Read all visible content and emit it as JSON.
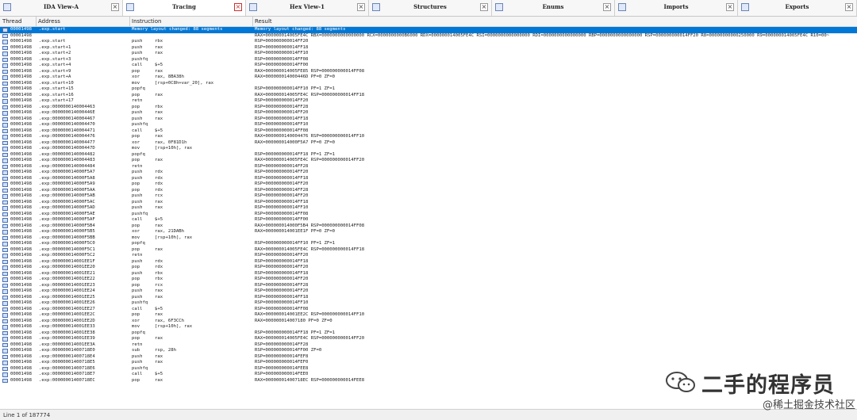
{
  "tabs": [
    {
      "label": "IDA View-A",
      "active": false
    },
    {
      "label": "Tracing",
      "active": true
    },
    {
      "label": "Hex View-1",
      "active": false
    },
    {
      "label": "Structures",
      "active": false
    },
    {
      "label": "Enums",
      "active": false
    },
    {
      "label": "Imports",
      "active": false
    },
    {
      "label": "Exports",
      "active": false
    }
  ],
  "columns": {
    "thread": "Thread",
    "address": "Address",
    "instruction": "Instruction",
    "result": "Result"
  },
  "rows": [
    {
      "t": "00001498",
      "a": ".exp.start",
      "m": "Memory layout changed: 88 segments",
      "o": "",
      "r": "Memory layout changed: 88 segments",
      "sel": true
    },
    {
      "t": "00001498",
      "a": "",
      "m": "",
      "o": "",
      "r": "RAX=000000014005FE4C RBX=0000000000000000 RCX=0000000000B6000 RDX=000000014005FE4C RSI=0000000000000000 RDI=0000000000000000 RBP=0000000000000000 RSP=000000000014FF20 R8=00000000000250000 R9=000000014005FE4C R10=00~"
    },
    {
      "t": "00001498",
      "a": ".exp.start",
      "m": "push",
      "o": "rbx",
      "r": "RSP=000000000014FF20"
    },
    {
      "t": "00001498",
      "a": ".exp.start+1",
      "m": "push",
      "o": "rax",
      "r": "RSP=000000000014FF18"
    },
    {
      "t": "00001498",
      "a": ".exp.start+2",
      "m": "push",
      "o": "rax",
      "r": "RSP=000000000014FF10"
    },
    {
      "t": "00001498",
      "a": ".exp.start+3",
      "m": "pushfq",
      "o": "",
      "r": "RSP=000000000014FF08"
    },
    {
      "t": "00001498",
      "a": ".exp.start+4",
      "m": "call",
      "o": "$+5",
      "r": "RSP=000000000014FF00"
    },
    {
      "t": "00001498",
      "a": ".exp.start+9",
      "m": "pop",
      "o": "rax",
      "r": "RAX=000000014005FE85 RSP=000000000014FF08"
    },
    {
      "t": "00001498",
      "a": ".exp.start+A",
      "m": "xor",
      "o": "rax, 8BA38h",
      "r": "RAX=000000014000446D PF=0 ZF=0"
    },
    {
      "t": "00001498",
      "a": ".exp.start+10",
      "m": "mov",
      "o": "[rsp+0C8h+var_20], rax",
      "r": ""
    },
    {
      "t": "00001498",
      "a": ".exp.start+15",
      "m": "popfq",
      "o": "",
      "r": "RSP=000000000014FF10 PF=1 ZF=1"
    },
    {
      "t": "00001498",
      "a": ".exp.start+16",
      "m": "pop",
      "o": "rax",
      "r": "RAX=000000014005FE4C RSP=000000000014FF18"
    },
    {
      "t": "00001498",
      "a": ".exp.start+17",
      "m": "retn",
      "o": "",
      "r": "RSP=000000000014FF20"
    },
    {
      "t": "00001498",
      "a": ".exp:0000000140004463",
      "m": "pop",
      "o": "rbx",
      "r": "RSP=000000000014FF28"
    },
    {
      "t": "00001498",
      "a": ".exp:000000014000446E",
      "m": "push",
      "o": "rax",
      "r": "RSP=000000000014FF20"
    },
    {
      "t": "00001498",
      "a": ".exp:0000000140004467",
      "m": "push",
      "o": "rax",
      "r": "RSP=000000000014FF18"
    },
    {
      "t": "00001498",
      "a": ".exp:0000000140004470",
      "m": "pushfq",
      "o": "",
      "r": "RSP=000000000014FF10"
    },
    {
      "t": "00001498",
      "a": ".exp:0000000140004471",
      "m": "call",
      "o": "$+5",
      "r": "RSP=000000000014FF08"
    },
    {
      "t": "00001498",
      "a": ".exp:0000000140004476",
      "m": "pop",
      "o": "rax",
      "r": "RAX=0000000140004476 RSP=000000000014FF10"
    },
    {
      "t": "00001498",
      "a": ".exp:0000000140004477",
      "m": "xor",
      "o": "rax, 0F81D1h",
      "r": "RAX=000000014000F5A7 PF=0 ZF=0"
    },
    {
      "t": "00001498",
      "a": ".exp:000000014000447D",
      "m": "mov",
      "o": "[rsp+10h], rax",
      "r": ""
    },
    {
      "t": "00001498",
      "a": ".exp:0000000140004482",
      "m": "popfq",
      "o": "",
      "r": "RSP=000000000014FF18 PF=1 ZF=1"
    },
    {
      "t": "00001498",
      "a": ".exp:0000000140004483",
      "m": "pop",
      "o": "rax",
      "r": "RAX=000000014005FE4C RSP=000000000014FF20"
    },
    {
      "t": "00001498",
      "a": ".exp:0000000140004484",
      "m": "retn",
      "o": "",
      "r": "RSP=000000000014FF28"
    },
    {
      "t": "00001498",
      "a": ".exp:000000014000F5A7",
      "m": "push",
      "o": "rdx",
      "r": "RSP=000000000014FF20"
    },
    {
      "t": "00001498",
      "a": ".exp:000000014000F5A8",
      "m": "push",
      "o": "rdx",
      "r": "RSP=000000000014FF18"
    },
    {
      "t": "00001498",
      "a": ".exp:000000014000F5A9",
      "m": "pop",
      "o": "rdx",
      "r": "RSP=000000000014FF20"
    },
    {
      "t": "00001498",
      "a": ".exp:000000014000F5AA",
      "m": "pop",
      "o": "rdx",
      "r": "RSP=000000000014FF28"
    },
    {
      "t": "00001498",
      "a": ".exp:000000014000F5AB",
      "m": "push",
      "o": "rcx",
      "r": "RSP=000000000014FF20"
    },
    {
      "t": "00001498",
      "a": ".exp:000000014000F5AC",
      "m": "push",
      "o": "rax",
      "r": "RSP=000000000014FF18"
    },
    {
      "t": "00001498",
      "a": ".exp:000000014000F5AD",
      "m": "push",
      "o": "rax",
      "r": "RSP=000000000014FF10"
    },
    {
      "t": "00001498",
      "a": ".exp:000000014000F5AE",
      "m": "pushfq",
      "o": "",
      "r": "RSP=000000000014FF08"
    },
    {
      "t": "00001498",
      "a": ".exp:000000014000F5AF",
      "m": "call",
      "o": "$+5",
      "r": "RSP=000000000014FF00"
    },
    {
      "t": "00001498",
      "a": ".exp:000000014000F5B4",
      "m": "pop",
      "o": "rax",
      "r": "RAX=000000014000F5B4 RSP=000000000014FF08"
    },
    {
      "t": "00001498",
      "a": ".exp:000000014000F5B5",
      "m": "xor",
      "o": "rax, 21DABh",
      "r": "RAX=000000014001EE1F PF=0 ZF=0"
    },
    {
      "t": "00001498",
      "a": ".exp:000000014000F5BB",
      "m": "mov",
      "o": "[rsp+10h], rax",
      "r": ""
    },
    {
      "t": "00001498",
      "a": ".exp:000000014000F5C0",
      "m": "popfq",
      "o": "",
      "r": "RSP=000000000014FF10 PF=1 ZF=1"
    },
    {
      "t": "00001498",
      "a": ".exp:000000014000F5C1",
      "m": "pop",
      "o": "rax",
      "r": "RAX=000000014005FE4C RSP=000000000014FF18"
    },
    {
      "t": "00001498",
      "a": ".exp:000000014000F5C2",
      "m": "retn",
      "o": "",
      "r": "RSP=000000000014FF20"
    },
    {
      "t": "00001498",
      "a": ".exp:000000014001EE1F",
      "m": "push",
      "o": "rdx",
      "r": "RSP=000000000014FF18"
    },
    {
      "t": "00001498",
      "a": ".exp:000000014001EE20",
      "m": "pop",
      "o": "rdx",
      "r": "RSP=000000000014FF20"
    },
    {
      "t": "00001498",
      "a": ".exp:000000014001EE21",
      "m": "push",
      "o": "rbx",
      "r": "RSP=000000000014FF18"
    },
    {
      "t": "00001498",
      "a": ".exp:000000014001EE22",
      "m": "pop",
      "o": "rbx",
      "r": "RSP=000000000014FF20"
    },
    {
      "t": "00001498",
      "a": ".exp:000000014001EE23",
      "m": "pop",
      "o": "rcx",
      "r": "RSP=000000000014FF28"
    },
    {
      "t": "00001498",
      "a": ".exp:000000014001EE24",
      "m": "push",
      "o": "rax",
      "r": "RSP=000000000014FF20"
    },
    {
      "t": "00001498",
      "a": ".exp:000000014001EE25",
      "m": "push",
      "o": "rax",
      "r": "RSP=000000000014FF18"
    },
    {
      "t": "00001498",
      "a": ".exp:000000014001EE26",
      "m": "pushfq",
      "o": "",
      "r": "RSP=000000000014FF10"
    },
    {
      "t": "00001498",
      "a": ".exp:000000014001EE27",
      "m": "call",
      "o": "$+5",
      "r": "RSP=000000000014FF08"
    },
    {
      "t": "00001498",
      "a": ".exp:000000014001EE2C",
      "m": "pop",
      "o": "rax",
      "r": "RAX=000000014001EE2C RSP=000000000014FF10"
    },
    {
      "t": "00001498",
      "a": ".exp:000000014001EE2D",
      "m": "xor",
      "o": "rax, 6F3CCh",
      "r": "RAX=000000014007180 PF=0 ZF=0"
    },
    {
      "t": "00001498",
      "a": ".exp:000000014001EE33",
      "m": "mov",
      "o": "[rsp+10h], rax",
      "r": ""
    },
    {
      "t": "00001498",
      "a": ".exp:000000014001EE38",
      "m": "popfq",
      "o": "",
      "r": "RSP=000000000014FF18 PF=1 ZF=1"
    },
    {
      "t": "00001498",
      "a": ".exp:000000014001EE39",
      "m": "pop",
      "o": "rax",
      "r": "RAX=000000014005FE4C RSP=000000000014FF20"
    },
    {
      "t": "00001498",
      "a": ".exp:000000014001EE3A",
      "m": "retn",
      "o": "",
      "r": "RSP=000000000014FF28"
    },
    {
      "t": "00001498",
      "a": ".exp:00000001400718E0",
      "m": "sub",
      "o": "rsp, 28h",
      "r": "RSP=000000000014FF00 ZF=0"
    },
    {
      "t": "00001498",
      "a": ".exp:00000001400718E4",
      "m": "push",
      "o": "rax",
      "r": "RSP=000000000014FEF8"
    },
    {
      "t": "00001498",
      "a": ".exp:00000001400718E5",
      "m": "push",
      "o": "rax",
      "r": "RSP=000000000014FEF0"
    },
    {
      "t": "00001498",
      "a": ".exp:00000001400718E6",
      "m": "pushfq",
      "o": "",
      "r": "RSP=000000000014FEE8"
    },
    {
      "t": "00001498",
      "a": ".exp:00000001400718E7",
      "m": "call",
      "o": "$+5",
      "r": "RSP=000000000014FEE0"
    },
    {
      "t": "00001498",
      "a": ".exp:00000001400718EC",
      "m": "pop",
      "o": "rax",
      "r": "RAX=00000001400718EC RSP=000000000014FEE8"
    }
  ],
  "status": {
    "text": "Line 1 of 187774"
  },
  "watermark": {
    "title": "二手的程序员",
    "subtitle": "@稀土掘金技术社区"
  }
}
